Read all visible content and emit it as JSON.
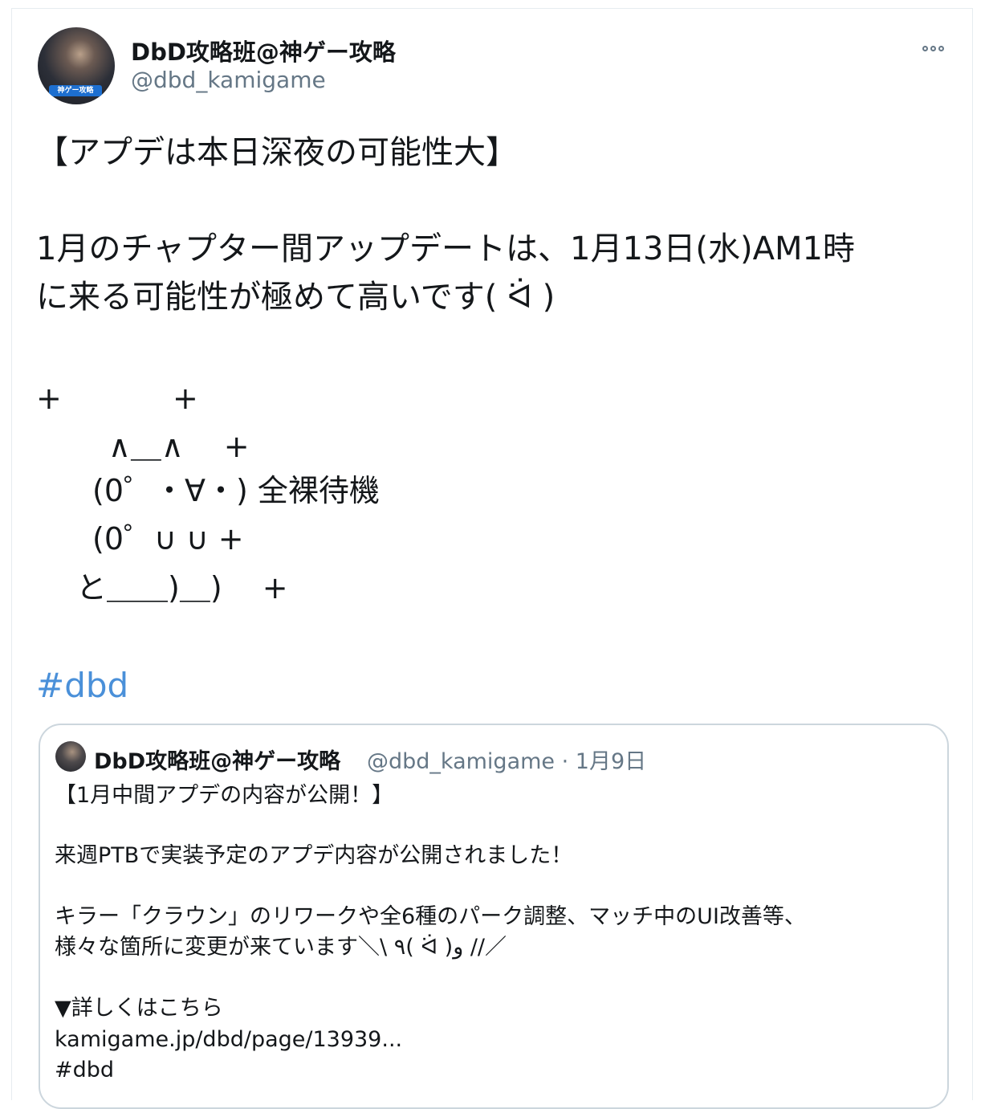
{
  "tweet": {
    "author_name": "DbD攻略班@神ゲー攻略",
    "author_handle": "@dbd_kamigame",
    "avatar_brand": "神ゲー攻略",
    "headline": "【アプデは本日深夜の可能性大】",
    "body_line1": "1月のチャプター間アップデートは、1月13日(水)AM1時",
    "body_line2": "に来る可能性が極めて高いです( ᐛ )",
    "ascii_art": {
      "row1_left": "+",
      "row1_right": "+",
      "row2": "∧＿∧　 +",
      "row3": "(0゜・∀・) 全裸待機",
      "row4": "(0゜∪ ∪ +",
      "row5": "と＿＿)＿)　 +"
    },
    "hashtag": "#dbd"
  },
  "quoted_tweet": {
    "author_name": "DbD攻略班@神ゲー攻略",
    "meta": "@dbd_kamigame · 1月9日",
    "line1": "【1月中間アプデの内容が公開！】",
    "line2": "来週PTBで実装予定のアプデ内容が公開されました！",
    "line3": "キラー「クラウン」のリワークや全6種のパーク調整、マッチ中のUI改善等、",
    "line4": "様々な箇所に変更が来ています＼\\ ٩( ᐛ )و //／",
    "line5": "▼詳しくはこちら",
    "line6": "kamigame.jp/dbd/page/13939...",
    "line7": "#dbd"
  }
}
